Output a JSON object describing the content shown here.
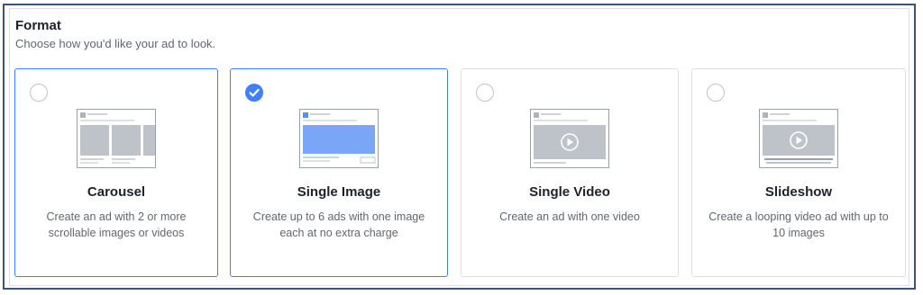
{
  "header": {
    "title": "Format",
    "subtitle": "Choose how you'd like your ad to look."
  },
  "options": [
    {
      "name": "Carousel",
      "description": "Create an ad with 2 or more scrollable images or videos",
      "selected": false,
      "icon": "carousel-icon"
    },
    {
      "name": "Single Image",
      "description": "Create up to 6 ads with one image each at no extra charge",
      "selected": true,
      "icon": "single-image-icon"
    },
    {
      "name": "Single Video",
      "description": "Create an ad with one video",
      "selected": false,
      "icon": "single-video-icon"
    },
    {
      "name": "Slideshow",
      "description": "Create a looping video ad with up to 10 images",
      "selected": false,
      "icon": "slideshow-icon"
    }
  ],
  "colors": {
    "accent": "#4080ff",
    "border": "#dddfe2",
    "frame": "#3d5478",
    "text": "#1d2129",
    "muted": "#606770"
  }
}
